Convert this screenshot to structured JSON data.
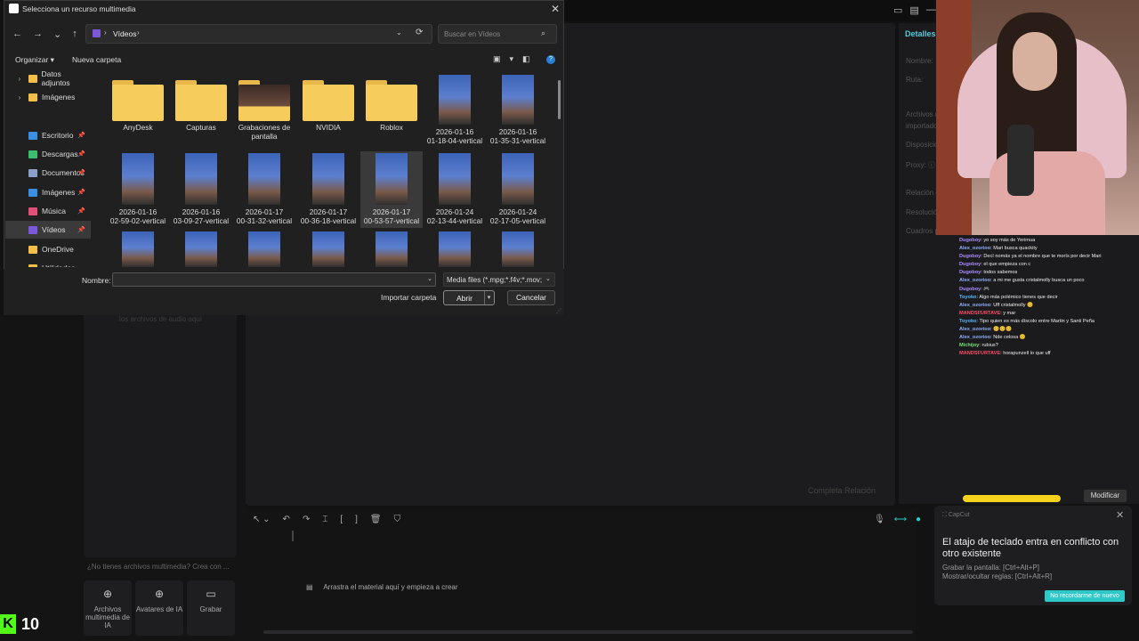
{
  "dialog": {
    "title": "Selecciona un recurso multimedia",
    "close": "✕",
    "nav": {
      "back": "←",
      "forward": "→",
      "recent": "⌄",
      "up": "↑"
    },
    "address": {
      "folder": "Vídeos",
      "chev": "›",
      "dd": "⌄",
      "refresh": "⟳"
    },
    "search_placeholder": "Buscar en Vídeos",
    "search_icon": "⌕",
    "organize": "Organizar ▾",
    "new_folder": "Nueva carpeta",
    "view_icons": [
      "▣",
      "▾",
      "◧"
    ],
    "help": "?",
    "sidebar": [
      {
        "label": "Datos adjuntos",
        "chev": "›",
        "icon_color": "#f2c04a",
        "pin": ""
      },
      {
        "label": "Imágenes",
        "chev": "›",
        "icon_color": "#f2c04a",
        "pin": ""
      },
      {
        "label": "Escritorio",
        "chev": "",
        "icon_color": "#3b8ee0",
        "pin": "📌"
      },
      {
        "label": "Descargas",
        "chev": "",
        "icon_color": "#3dbd6f",
        "pin": "📌"
      },
      {
        "label": "Documentos",
        "chev": "",
        "icon_color": "#8aa0c8",
        "pin": "📌"
      },
      {
        "label": "Imágenes",
        "chev": "",
        "icon_color": "#3b8ee0",
        "pin": "📌"
      },
      {
        "label": "Música",
        "chev": "",
        "icon_color": "#e0507a",
        "pin": "📌"
      },
      {
        "label": "Vídeos",
        "chev": "",
        "icon_color": "#7b57d9",
        "pin": "📌"
      },
      {
        "label": "OneDrive",
        "chev": "",
        "icon_color": "#f2c04a",
        "pin": ""
      },
      {
        "label": "Utilidades",
        "chev": "",
        "icon_color": "#f2c04a",
        "pin": ""
      }
    ],
    "items": [
      {
        "kind": "folder",
        "l1": "AnyDesk",
        "l2": ""
      },
      {
        "kind": "folder",
        "l1": "Capturas",
        "l2": ""
      },
      {
        "kind": "folder-photo",
        "l1": "Grabaciones de",
        "l2": "pantalla"
      },
      {
        "kind": "folder",
        "l1": "NVIDIA",
        "l2": ""
      },
      {
        "kind": "folder",
        "l1": "Roblox",
        "l2": ""
      },
      {
        "kind": "video",
        "l1": "2026-01-16",
        "l2": "01-18-04-vertical"
      },
      {
        "kind": "video",
        "l1": "2026-01-16",
        "l2": "01-35-31-vertical"
      },
      {
        "kind": "video",
        "l1": "2026-01-16",
        "l2": "02-59-02-vertical"
      },
      {
        "kind": "video",
        "l1": "2026-01-16",
        "l2": "03-09-27-vertical"
      },
      {
        "kind": "video",
        "l1": "2026-01-17",
        "l2": "00-31-32-vertical"
      },
      {
        "kind": "video",
        "l1": "2026-01-17",
        "l2": "00-36-18-vertical"
      },
      {
        "kind": "video",
        "l1": "2026-01-17",
        "l2": "00-53-57-vertical"
      },
      {
        "kind": "video",
        "l1": "2026-01-24",
        "l2": "02-13-44-vertical"
      },
      {
        "kind": "video",
        "l1": "2026-01-24",
        "l2": "02-17-05-vertical"
      },
      {
        "kind": "video",
        "l1": "",
        "l2": ""
      },
      {
        "kind": "video",
        "l1": "",
        "l2": ""
      },
      {
        "kind": "video",
        "l1": "",
        "l2": ""
      },
      {
        "kind": "video",
        "l1": "",
        "l2": ""
      },
      {
        "kind": "video",
        "l1": "",
        "l2": ""
      },
      {
        "kind": "video",
        "l1": "",
        "l2": ""
      },
      {
        "kind": "video",
        "l1": "",
        "l2": ""
      }
    ],
    "name_label": "Nombre:",
    "name_value": "",
    "filter": "Media files (*.mpg;*.f4v;*.mov;",
    "import_folder": "Importar carpeta",
    "open": "Abrir",
    "open_dd": "▾",
    "cancel": "Cancelar"
  },
  "app": {
    "details_title": "Detalles",
    "detail_labels": [
      "Nombre:",
      "Ruta:",
      "Archivos n",
      "importado",
      "Disposició",
      "Proxy: ⓘ",
      "Relación d",
      "Resolució",
      "Cuadros p"
    ],
    "modify": "Modificar",
    "media_drop_hint": "los archivos de audio aquí",
    "no_media": "¿No tienes archivos multimedia? Crea con ...",
    "media_buttons": [
      {
        "icon": "⊕",
        "label": "Archivos multimedia de IA"
      },
      {
        "icon": "⊕",
        "label": "Avatares de IA"
      },
      {
        "icon": "▭",
        "label": "Grabar"
      }
    ],
    "timeline_tools": [
      "↖ ⌄",
      "↶",
      "↷",
      "⌶",
      "[",
      "]",
      "🗑",
      "⛉"
    ],
    "timeline_right": [
      "🎙",
      "⟷",
      "●"
    ],
    "timeline_drop": "Arrastra el material aquí y empieza a crear",
    "timeline_drop_icon": "▤",
    "win_ctrls": [
      "▭",
      "▤",
      "—"
    ],
    "preview_bottom": "Completa   Relación"
  },
  "chat": [
    {
      "user": "Dugoboy",
      "ucolor": "#a98bff",
      "msg": ": yo soy más de Yerimua"
    },
    {
      "user": "Alex_ozorioo",
      "ucolor": "#8db0ff",
      "msg": ": Mari busca quackity"
    },
    {
      "user": "Dugoboy",
      "ucolor": "#a98bff",
      "msg": ": Decí nomás ya el nombre que te morís por decir Mari"
    },
    {
      "user": "Dugoboy",
      "ucolor": "#a98bff",
      "msg": ": el que empieza con c"
    },
    {
      "user": "Dugoboy",
      "ucolor": "#a98bff",
      "msg": ": todos sabemos"
    },
    {
      "user": "Alex_ozorioo",
      "ucolor": "#8db0ff",
      "msg": ": a mi me gusta cristalmolly busca un poco"
    },
    {
      "user": "Dugoboy",
      "ucolor": "#a98bff",
      "msg": ": 🎮"
    },
    {
      "user": "Toyoko",
      "ucolor": "#56b8ff",
      "msg": ": Algo más polémico tienes que decir"
    },
    {
      "user": "Alex_ozorioo",
      "ucolor": "#8db0ff",
      "msg": ": Uff cristalmolly 😊"
    },
    {
      "user": "MANDSFURTAVE",
      "ucolor": "#ff4a6a",
      "msg": ": y mar"
    },
    {
      "user": "Toyoko",
      "ucolor": "#56b8ff",
      "msg": ": Tipo quien es más díscolo entre Martin y Santi Peña"
    },
    {
      "user": "Alex_ozorioo",
      "ucolor": "#8db0ff",
      "msg": ": 😊😊😊"
    },
    {
      "user": "Alex_ozorioo",
      "ucolor": "#8db0ff",
      "msg": ": Nde celosa 😊"
    },
    {
      "user": "Michijoy",
      "ucolor": "#7be07b",
      "msg": ": rubius?"
    },
    {
      "user": "MANDSFURTAVE",
      "ucolor": "#ff4a6a",
      "msg": ": horapunzell lo que uff"
    }
  ],
  "notification": {
    "app": "⛶ CapCut",
    "close": "✕",
    "title": "El atajo de teclado entra en conflicto con otro existente",
    "line1": "Grabar la pantalla: [Ctrl+Alt+P]",
    "line2": "Mostrar/ocultar reglas: [Ctrl+Alt+R]",
    "button": "No recordarme de nuevo"
  },
  "overlay": {
    "kick": "K",
    "count": "10"
  }
}
